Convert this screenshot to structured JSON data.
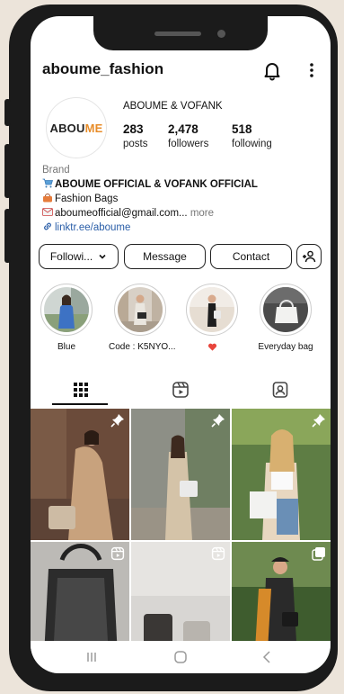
{
  "profile": {
    "username": "aboume_fashion",
    "full_name": "ABOUME & VOFANK",
    "logo_part1": "ABOU",
    "logo_part2": "ME",
    "posts_count": "283",
    "posts_label": "posts",
    "followers_count": "2,478",
    "followers_label": "followers",
    "following_count": "518",
    "following_label": "following"
  },
  "bio": {
    "category": "Brand",
    "line1": "ABOUME OFFICIAL & VOFANK OFFICIAL",
    "line2": "Fashion Bags",
    "email": "aboumeofficial@gmail.com...",
    "more": "more",
    "link": "linktr.ee/aboume"
  },
  "actions": {
    "following": "Followi...",
    "message": "Message",
    "contact": "Contact"
  },
  "highlights": [
    {
      "label": "Blue"
    },
    {
      "label": "Code : K5NYO..."
    },
    {
      "label": ""
    },
    {
      "label": "Everyday bag"
    }
  ],
  "icons": {
    "bell": "bell-icon",
    "more": "more-vertical-icon",
    "grid": "grid-icon",
    "reels": "reels-icon",
    "tagged": "tagged-icon",
    "pin": "pin-icon"
  },
  "colors": {
    "brand_accent": "#e88d2a",
    "link": "#2a5ea8"
  }
}
